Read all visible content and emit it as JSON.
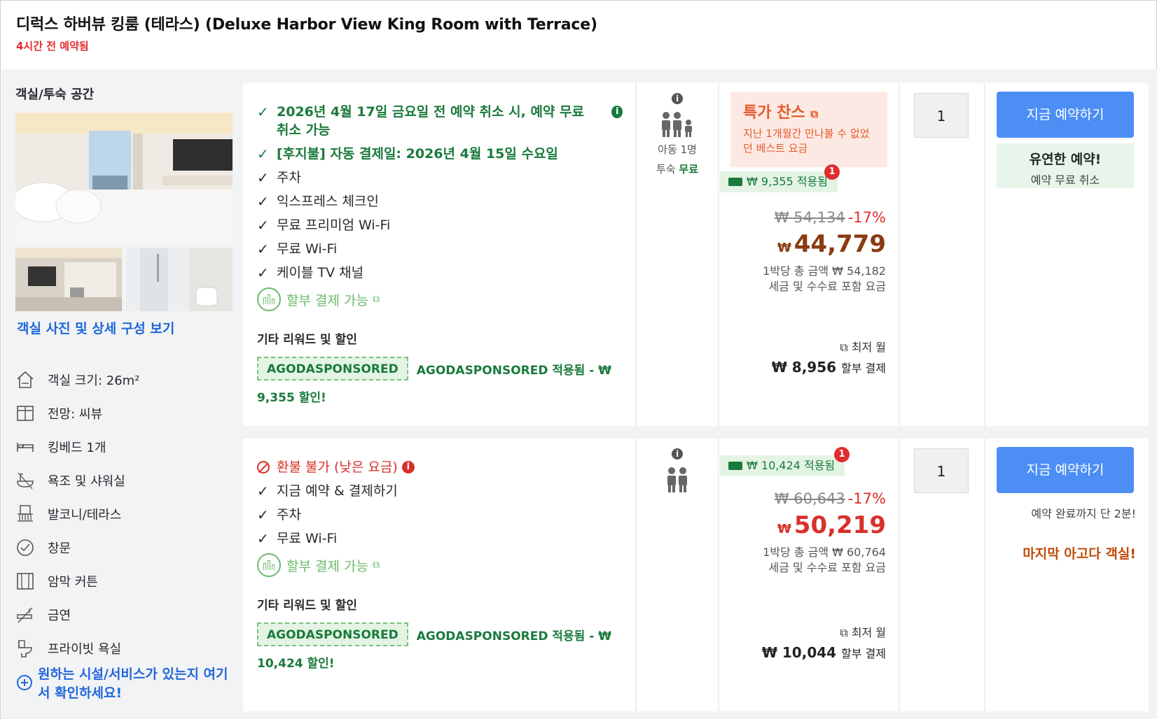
{
  "header": {
    "title": "디럭스 하버뷰 킹룸 (테라스) (Deluxe Harbor View King Room with Terrace)",
    "booked_ago": "4시간 전 예약됨"
  },
  "room": {
    "section_title": "객실/투숙 공간",
    "photos_link": "객실 사진 및 상세 구성 보기",
    "features": [
      {
        "label": "객실 크기: 26m²",
        "icon": "room-size-icon"
      },
      {
        "label": "전망: 씨뷰",
        "icon": "window-view-icon"
      },
      {
        "label": "킹베드 1개",
        "icon": "bed-icon"
      },
      {
        "label": "욕조 및 샤워실",
        "icon": "bathtub-shower-icon"
      },
      {
        "label": "발코니/테라스",
        "icon": "balcony-icon"
      },
      {
        "label": "창문",
        "icon": "window-check-icon"
      },
      {
        "label": "암막 커튼",
        "icon": "blackout-curtain-icon"
      },
      {
        "label": "금연",
        "icon": "no-smoking-icon"
      },
      {
        "label": "프라이빗 욕실",
        "icon": "private-bathroom-icon"
      }
    ],
    "facility_link": "원하는 시설/서비스가 있는지 여기서 확인하세요!"
  },
  "offers": [
    {
      "benefits_green": [
        "2026년 4월 17일 금요일 전 예약 취소 시, 예약 무료 취소 가능",
        "[후지불] 자동 결제일: 2026년 4월 15일 수요일"
      ],
      "benefits": [
        "주차",
        "익스프레스 체크인",
        "무료 프리미엄 Wi-Fi",
        "무료 Wi-Fi",
        "케이블 TV 채널"
      ],
      "installment": "할부 결제 가능",
      "rewards_title": "기타 리워드 및 할인",
      "coupon_code": "AGODASPONSORED",
      "coupon_applied": "AGODASPONSORED 적용됨 - ₩",
      "coupon_tail": "9,355 할인!",
      "occupancy": {
        "child": "아동 1명",
        "stay_label": "투숙",
        "stay_value": "무료"
      },
      "deal": {
        "title": "특가 찬스",
        "subtitle": "지난 1개월간 만나볼 수 없었던 베스트 요금"
      },
      "applied_discount": "₩ 9,355 적용됨",
      "badge_count": "1",
      "original_price": "₩ 54,134",
      "discount_pct": "-17%",
      "currency": "₩",
      "final_price": "44,779",
      "per_night": "1박당 총 금액 ₩ 54,182",
      "tax_note": "세금 및 수수료 포함 요금",
      "monthly_label": "최저 월",
      "monthly_amount": "₩ 8,956",
      "monthly_suffix": "할부 결제",
      "quantity": "1",
      "book_label": "지금 예약하기",
      "flex_title": "유연한 예약!",
      "flex_sub": "예약 무료 취소"
    },
    {
      "nonrefundable": "환불 불가 (낮은 요금)",
      "benefits": [
        "지금 예약 & 결제하기",
        "주차",
        "무료 Wi-Fi"
      ],
      "installment": "할부 결제 가능",
      "rewards_title": "기타 리워드 및 할인",
      "coupon_code": "AGODASPONSORED",
      "coupon_applied": "AGODASPONSORED 적용됨 - ₩",
      "coupon_tail": "10,424 할인!",
      "applied_discount": "₩ 10,424 적용됨",
      "badge_count": "1",
      "original_price": "₩ 60,643",
      "discount_pct": "-17%",
      "currency": "₩",
      "final_price": "50,219",
      "per_night": "1박당 총 금액 ₩ 60,764",
      "tax_note": "세금 및 수수료 포함 요금",
      "monthly_label": "최저 월",
      "monthly_amount": "₩ 10,044",
      "monthly_suffix": "할부 결제",
      "quantity": "1",
      "book_label": "지금 예약하기",
      "minutes_note": "예약 완료까지 단 2분!",
      "last_room": "마지막 아고다 객실!"
    }
  ],
  "colors": {
    "link_blue": "#2067da",
    "green": "#1a7a3c",
    "red": "#d8312a",
    "book_button": "#4d8ef5",
    "deal_bg": "#fde9e3"
  }
}
